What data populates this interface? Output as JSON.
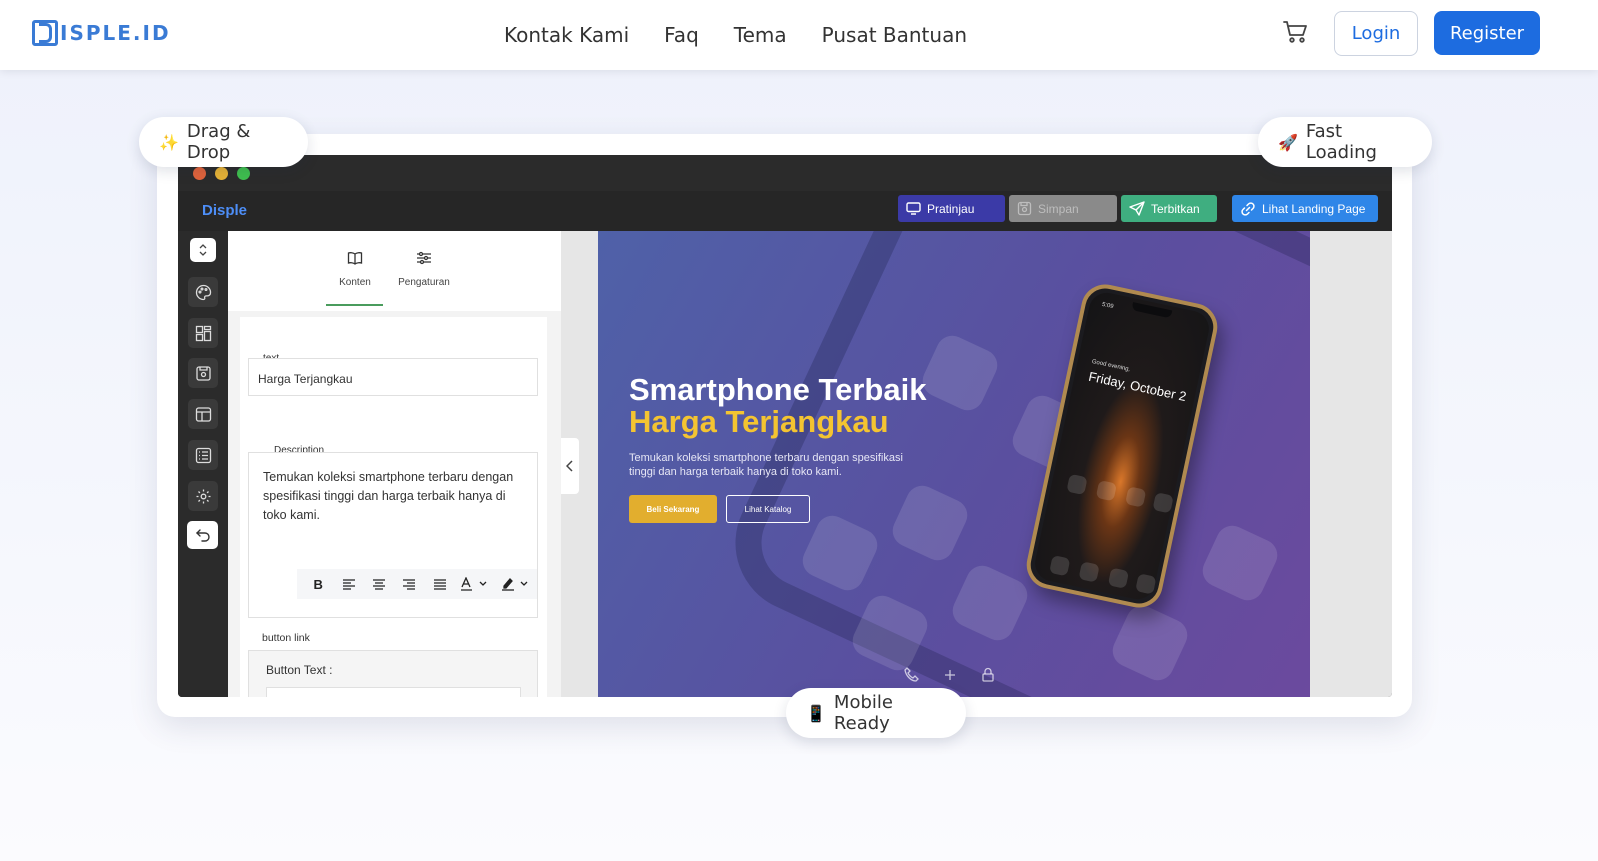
{
  "brand": {
    "logo_text": "ISPLE.ID",
    "accent": "#1d6ce0"
  },
  "nav": {
    "links": [
      "Kontak Kami",
      "Faq",
      "Tema",
      "Pusat Bantuan"
    ],
    "login_label": "Login",
    "register_label": "Register"
  },
  "badges": {
    "drag_drop": {
      "emoji": "✨",
      "label": "Drag & Drop"
    },
    "fast_loading": {
      "emoji": "🚀",
      "label": "Fast Loading"
    },
    "mobile_ready": {
      "emoji": "📱",
      "label": "Mobile Ready"
    }
  },
  "editor": {
    "app_title": "Disple",
    "actions": {
      "preview": "Pratinjau",
      "save": "Simpan",
      "publish": "Terbitkan",
      "landing": "Lihat Landing Page"
    },
    "panel": {
      "tab_content": "Konten",
      "tab_settings": "Pengaturan",
      "text_label": "text",
      "text_value": "Harga Terjangkau",
      "description_label": "Description",
      "description_value": "Temukan koleksi smartphone terbaru dengan spesifikasi tinggi dan harga terbaik hanya di toko kami.",
      "button_link_label": "button link",
      "button_text_label": "Button Text :"
    }
  },
  "preview": {
    "title_line1": "Smartphone Terbaik",
    "title_line2": "Harga Terjangkau",
    "description": "Temukan koleksi smartphone terbaru dengan spesifikasi tinggi dan harga terbaik hanya di toko kami.",
    "primary_button": "Beli Sekarang",
    "secondary_button": "Lihat Katalog",
    "phone": {
      "greeting": "Good evening,",
      "date": "Friday, October 2",
      "time": "5:09"
    }
  }
}
